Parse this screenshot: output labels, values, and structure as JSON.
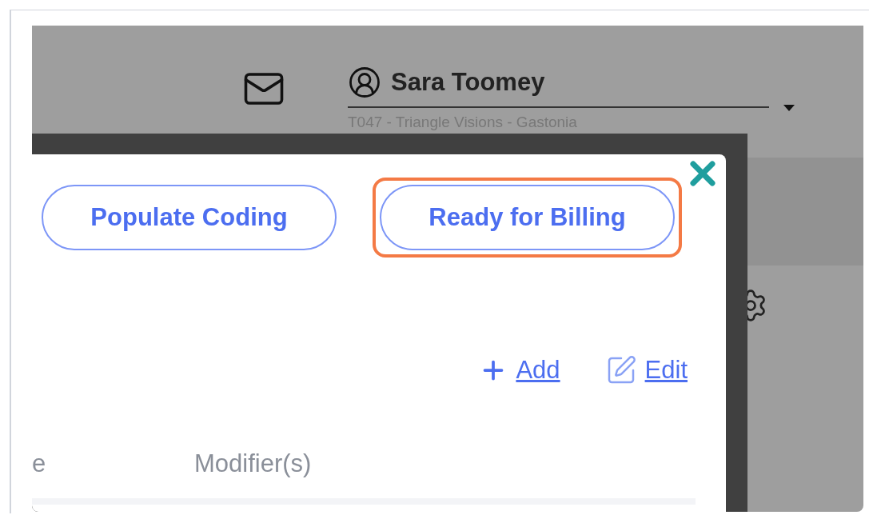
{
  "header": {
    "user": {
      "name": "Sara Toomey",
      "location": "T047 - Triangle Visions - Gastonia"
    }
  },
  "modal": {
    "buttons": [
      {
        "label": "Populate Coding",
        "highlighted": false
      },
      {
        "label": "Ready for Billing",
        "highlighted": true
      }
    ],
    "actions": [
      {
        "kind": "add",
        "label": "Add"
      },
      {
        "kind": "edit",
        "label": "Edit"
      }
    ],
    "table": {
      "columns": [
        "e",
        "Modifier(s)"
      ]
    }
  }
}
